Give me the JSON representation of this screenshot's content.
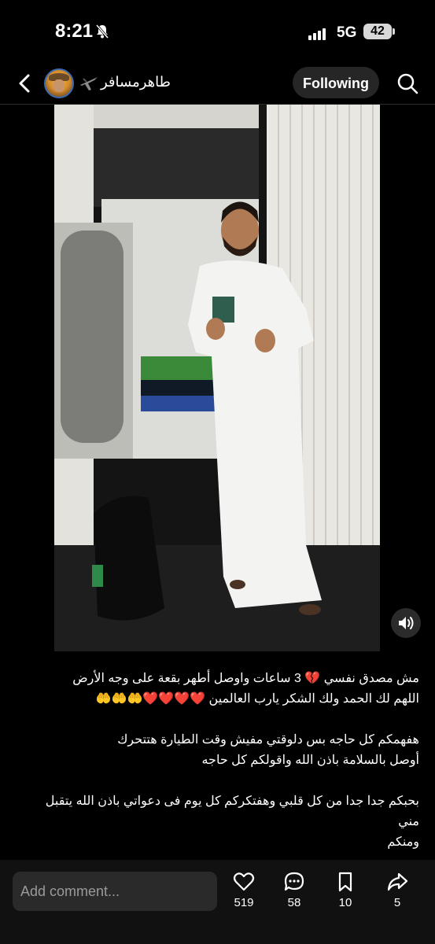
{
  "status": {
    "time": "8:21",
    "network": "5G",
    "battery": "42"
  },
  "header": {
    "username": "طاهرمسافر",
    "follow_label": "Following"
  },
  "post": {
    "caption_lines": [
      "مش مصدق نفسي 💔 3 ساعات واوصل أطهر بقعة على وجه الأرض",
      "اللهم لك الحمد ولك الشكر يارب العالمين ❤️❤️❤️❤️🤲🤲🤲",
      "",
      "هفهمكم كل حاجه بس دلوقتي مفيش وقت الطيارة هتتحرك",
      "أوصل بالسلامة باذن الله واقولكم كل حاجه",
      "",
      "بحبكم جدا جدا من كل قلبي وهفتكركم كل يوم فى دعواتي باذن الله يتقبل مني",
      "ومنكم"
    ]
  },
  "bottom_bar": {
    "comment_placeholder": "Add comment...",
    "likes": "519",
    "comments": "58",
    "saves": "10",
    "shares": "5"
  }
}
